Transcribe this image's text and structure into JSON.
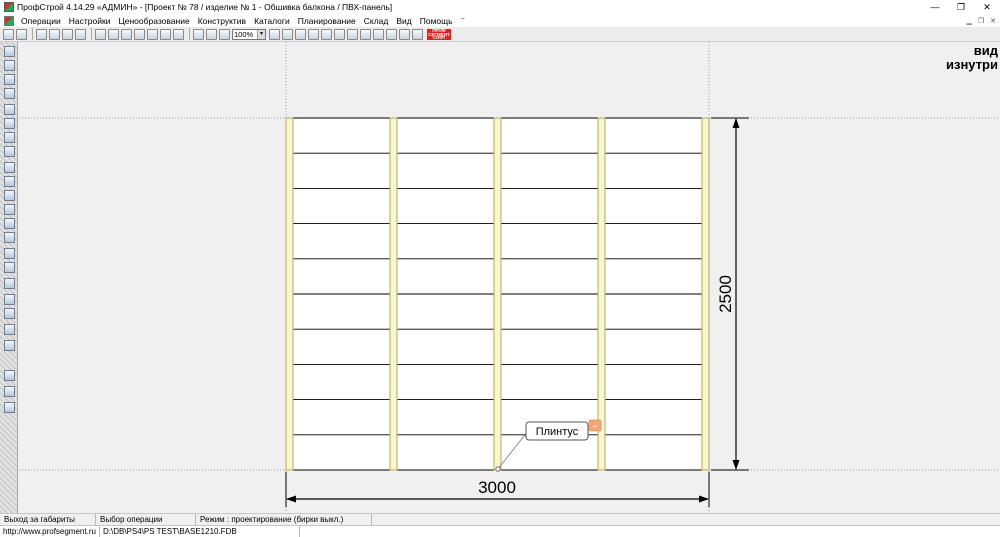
{
  "window": {
    "title": "ПрофСтрой 4.14.29 «АДМИН» - [Проект № 78 / изделие № 1  -  Обшивка балкона / ПВХ-панель]",
    "minimize_glyph": "—",
    "restore_glyph": "❐",
    "close_glyph": "✕"
  },
  "menu": {
    "items": [
      "Операции",
      "Настройки",
      "Ценообразование",
      "Конструктив",
      "Каталоги",
      "Планирование",
      "Склад",
      "Вид",
      "Помощь"
    ],
    "extra": "⁻"
  },
  "toolbar": {
    "zoom_value": "100%",
    "logo_text": [
      "ПРОФ",
      "СЕГМЕНТ",
      "СОФТ"
    ]
  },
  "view": {
    "label_line1": "вид",
    "label_line2": "изнутри"
  },
  "drawing": {
    "width_dimension": "3000",
    "height_dimension": "2500",
    "callout_label": "Плинтус",
    "callout_badge": "−",
    "post_count": 5,
    "panel_rows": 10,
    "colors": {
      "post_fill": "#faf6d2",
      "post_stroke": "#b2a85a",
      "panel_fill": "#ffffff",
      "line": "#000000",
      "badge": "#f4a57a"
    }
  },
  "status": {
    "cell1": "Выход за габариты",
    "cell2": "Выбор операции",
    "cell3": "Режим : проектирование  (бирки выкл.)"
  },
  "footer": {
    "website": "http://www.profsegment.ru",
    "db_path": "D:\\DB\\PS4\\PS TEST\\BASE1210.FDB"
  }
}
